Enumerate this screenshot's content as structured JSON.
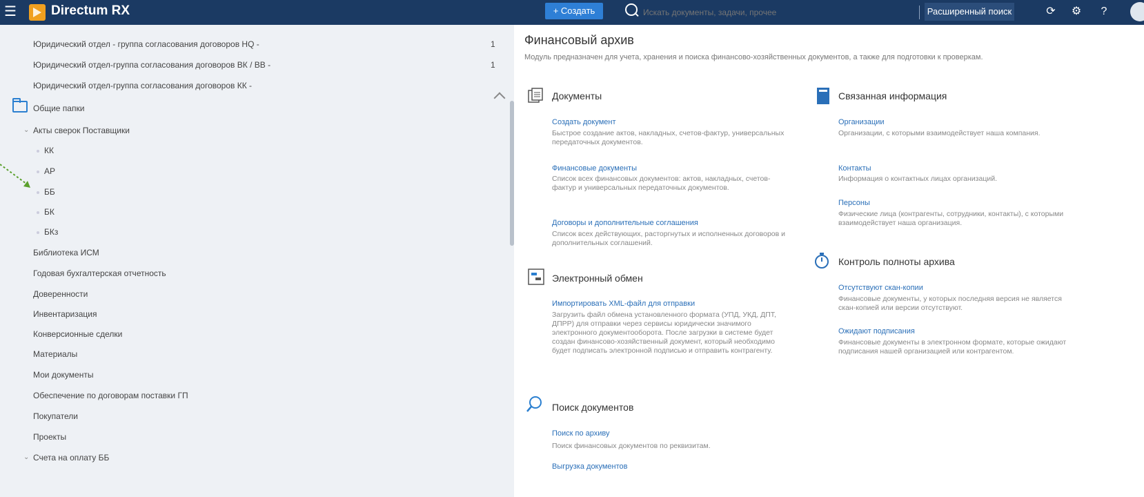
{
  "topbar": {
    "app_title": "Directum RX",
    "create_label": "+ Создать",
    "search_placeholder": "Искать документы, задачи, прочее",
    "advanced_search_label": "Расширенный поиск"
  },
  "tree": {
    "rows": [
      {
        "label": "Юридический отдел - группа согласования договоров HQ -",
        "count": "1"
      },
      {
        "label": "Юридический отдел-группа согласования договоров ВК / ВВ -",
        "count": "1"
      },
      {
        "label": "Юридический отдел-группа согласования договоров КК -",
        "count": ""
      }
    ],
    "shared_folders_label": "Общие папки",
    "reconciliation_label": "Акты сверок Поставщики",
    "reconciliation_children": [
      "КК",
      "АР",
      "ББ",
      "БК",
      "БКз"
    ],
    "folders": [
      "Библиотека ИСМ",
      "Годовая бухгалтерская отчетность",
      "Доверенности",
      "Инвентаризация",
      "Конверсионные сделки",
      "Материалы",
      "Мои документы",
      "Обеспечение по договорам поставки ГП",
      "Покупатели",
      "Проекты"
    ],
    "invoices_label": "Счета на оплату ББ"
  },
  "main": {
    "title": "Финансовый архив",
    "description": "Модуль предназначен для учета, хранения и поиска финансово-хозяйственных документов, а также для подготовки к проверкам.",
    "documents": {
      "title": "Документы",
      "items": [
        {
          "link": "Создать документ",
          "desc": "Быстрое создание актов, накладных, счетов-фактур, универсальных передаточных документов."
        },
        {
          "link": "Финансовые документы",
          "desc": "Список всех финансовых документов: актов, накладных, счетов-фактур и универсальных передаточных документов."
        },
        {
          "link": "Договоры и дополнительные соглашения",
          "desc": "Список всех действующих, расторгнутых и исполненных договоров и дополнительных соглашений."
        }
      ]
    },
    "exchange": {
      "title": "Электронный обмен",
      "items": [
        {
          "link": "Импортировать XML-файл для отправки",
          "desc": "Загрузить файл обмена установленного формата (УПД, УКД, ДПТ, ДПРР) для отправки через сервисы юридически значимого электронного документооборота. После загрузки в системе будет создан финансово-хозяйственный документ, который необходимо будет подписать электронной подписью и отправить контрагенту."
        }
      ]
    },
    "search": {
      "title": "Поиск документов",
      "items": [
        {
          "link": "Поиск по архиву",
          "desc": "Поиск финансовых документов по реквизитам."
        },
        {
          "link": "Выгрузка документов",
          "desc": ""
        }
      ]
    },
    "related": {
      "title": "Связанная информация",
      "items": [
        {
          "link": "Организации",
          "desc": "Организации, с которыми взаимодействует наша компания."
        },
        {
          "link": "Контакты",
          "desc": "Информация о контактных лицах организаций."
        },
        {
          "link": "Персоны",
          "desc": "Физические лица (контрагенты, сотрудники, контакты), с которыми взаимодействует наша организация."
        }
      ]
    },
    "completeness": {
      "title": "Контроль полноты архива",
      "items": [
        {
          "link": "Отсутствуют скан-копии",
          "desc": "Финансовые документы, у которых последняя версия не является скан-копией или версии отсутствуют."
        },
        {
          "link": "Ожидают подписания",
          "desc": "Финансовые документы в электронном формате, которые ожидают подписания нашей организацией или контрагентом."
        }
      ]
    }
  }
}
